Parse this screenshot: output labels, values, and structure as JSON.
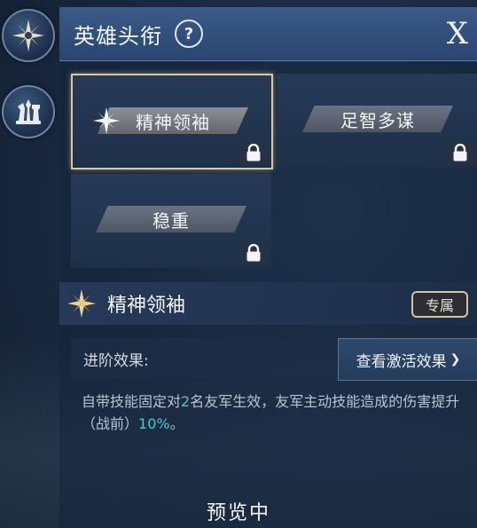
{
  "header": {
    "title": "英雄头衔",
    "help_label": "?",
    "close_label": "X"
  },
  "side_icons": [
    {
      "name": "compass-star-icon"
    },
    {
      "name": "chess-pieces-icon"
    }
  ],
  "titles": [
    {
      "label": "精神领袖",
      "selected": true,
      "locked": true
    },
    {
      "label": "足智多谋",
      "selected": false,
      "locked": true
    },
    {
      "label": "稳重",
      "selected": false,
      "locked": true
    }
  ],
  "detail": {
    "title": "精神领袖",
    "badge": "专属",
    "advance_label": "进阶效果:",
    "view_button": "查看激活效果",
    "view_chevron": "❯",
    "desc_part1": "自带技能固定对",
    "desc_num1": "2",
    "desc_part2": "名友军生效，友军主动技能造成的伤害提升（战前）",
    "desc_num2": "10%",
    "desc_part3": "。"
  },
  "footer": {
    "status": "预览中"
  },
  "colors": {
    "highlight": "#4bc6cf",
    "selected_border": "#d8c89a"
  }
}
